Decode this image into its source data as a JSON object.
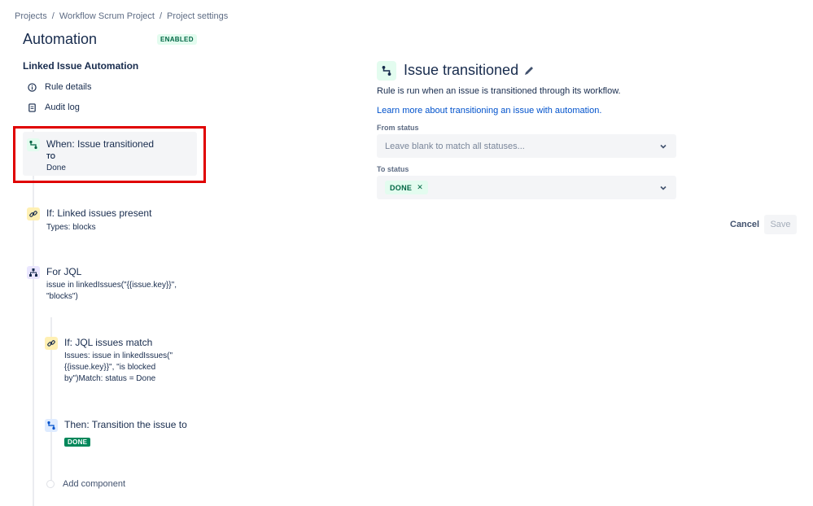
{
  "breadcrumb": [
    "Projects",
    "Workflow Scrum Project",
    "Project settings"
  ],
  "page": {
    "title": "Automation",
    "badge": "ENABLED"
  },
  "rule": {
    "name": "Linked Issue Automation"
  },
  "nav": {
    "rule_details": "Rule details",
    "audit_log": "Audit log"
  },
  "components": {
    "trigger": {
      "title": "When: Issue transitioned",
      "to_label": "TO",
      "to_value": "Done"
    },
    "condition1": {
      "title": "If: Linked issues present",
      "sub": "Types: blocks"
    },
    "branch": {
      "title": "For JQL",
      "sub1": "issue in linkedIssues(\"{{issue.key}}\",",
      "sub2": "\"blocks\")"
    },
    "condition2": {
      "title": "If: JQL issues match",
      "sub1": "Issues: issue in linkedIssues(\"",
      "sub2": "{{issue.key}}\", \"is blocked",
      "sub3": "by\")Match: status = Done"
    },
    "action": {
      "title": "Then: Transition the issue to",
      "status": "DONE"
    },
    "add_component": "Add component"
  },
  "panel": {
    "title": "Issue transitioned",
    "description": "Rule is run when an issue is transitioned through its workflow.",
    "link": "Learn more about transitioning an issue with automation.",
    "from_label": "From status",
    "from_placeholder": "Leave blank to match all statuses...",
    "to_label": "To status",
    "to_value": "DONE",
    "cancel": "Cancel",
    "save": "Save"
  },
  "colors": {
    "accent": "#0052cc",
    "success": "#00875a",
    "highlight": "#e00000"
  }
}
